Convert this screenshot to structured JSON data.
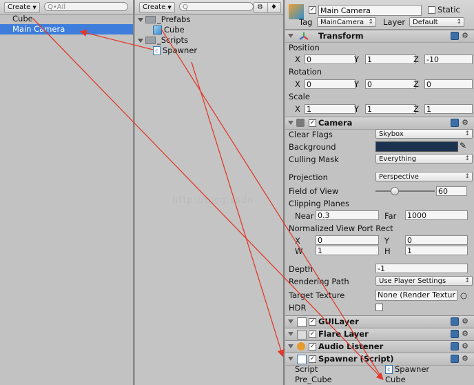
{
  "hierarchy": {
    "create_label": "Create",
    "search_placeholder": "Q•All",
    "items": [
      "Cube",
      "Main Camera"
    ]
  },
  "project": {
    "create_label": "Create",
    "search_placeholder": "Q",
    "items": [
      {
        "label": "_Prefabs",
        "type": "folder"
      },
      {
        "label": "Cube",
        "type": "prefab"
      },
      {
        "label": "_Scripts",
        "type": "folder"
      },
      {
        "label": "Spawner",
        "type": "script"
      }
    ]
  },
  "inspector": {
    "object_name": "Main Camera",
    "static_label": "Static",
    "tag_label": "Tag",
    "tag_value": "MainCamera",
    "layer_label": "Layer",
    "layer_value": "Default",
    "transform": {
      "title": "Transform",
      "position_label": "Position",
      "rotation_label": "Rotation",
      "scale_label": "Scale",
      "x": "X",
      "y": "Y",
      "z": "Z",
      "position": [
        "0",
        "1",
        "-10"
      ],
      "rotation": [
        "0",
        "0",
        "0"
      ],
      "scale": [
        "1",
        "1",
        "1"
      ]
    },
    "camera": {
      "title": "Camera",
      "clear_flags_label": "Clear Flags",
      "clear_flags": "Skybox",
      "background_label": "Background",
      "background_color": "#1c3350",
      "culling_mask_label": "Culling Mask",
      "culling_mask": "Everything",
      "projection_label": "Projection",
      "projection": "Perspective",
      "fov_label": "Field of View",
      "fov": "60",
      "clipping_label": "Clipping Planes",
      "near_label": "Near",
      "near": "0.3",
      "far_label": "Far",
      "far": "1000",
      "viewport_label": "Normalized View Port Rect",
      "x_label": "X",
      "y_label": "Y",
      "w_label": "W",
      "h_label": "H",
      "vp_x": "0",
      "vp_y": "0",
      "vp_w": "1",
      "vp_h": "1",
      "depth_label": "Depth",
      "depth": "-1",
      "rendering_path_label": "Rendering Path",
      "rendering_path": "Use Player Settings",
      "target_texture_label": "Target Texture",
      "target_texture": "None (Render Textur",
      "hdr_label": "HDR"
    },
    "components": [
      "GUILayer",
      "Flare Layer",
      "Audio Listener"
    ],
    "spawner": {
      "title": "Spawner (Script)",
      "script_label": "Script",
      "script_value": "Spawner",
      "pre_cube_label": "Pre_Cube",
      "pre_cube_value": "Cube"
    }
  },
  "watermark": "http://blog.csdn",
  "colors": {
    "selection": "#3e7ddb",
    "arrow": "#e03a2a"
  }
}
